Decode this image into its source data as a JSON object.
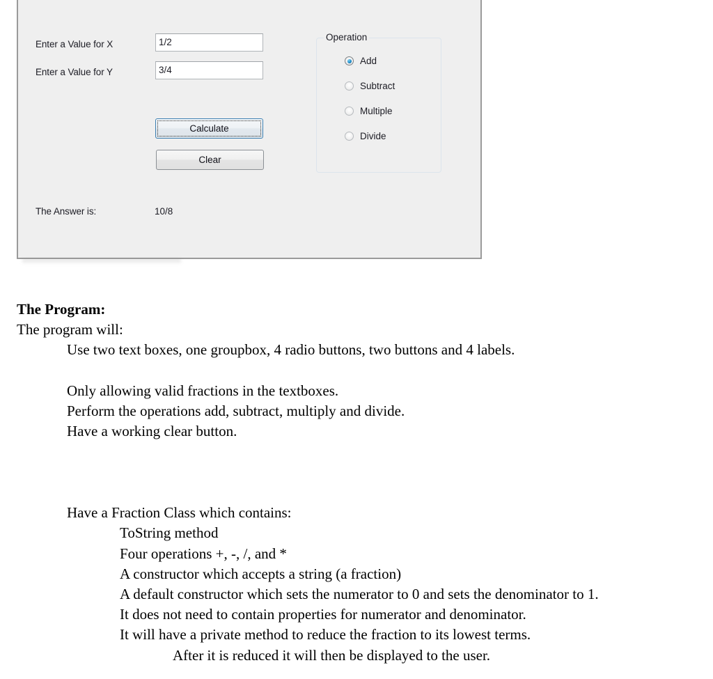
{
  "winform": {
    "labels": {
      "x": "Enter a Value for X",
      "y": "Enter a Value for Y",
      "answer": "The Answer is:"
    },
    "inputs": {
      "x_value": "1/2",
      "y_value": "3/4"
    },
    "answer_value": "10/8",
    "buttons": {
      "calculate": "Calculate",
      "clear": "Clear"
    },
    "groupbox": {
      "title": "Operation",
      "options": [
        {
          "label": "Add",
          "checked": true
        },
        {
          "label": "Subtract",
          "checked": false
        },
        {
          "label": "Multiple",
          "checked": false
        },
        {
          "label": "Divide",
          "checked": false
        }
      ]
    },
    "colors": {
      "form_background": "#efefef",
      "focus_border": "#3c7fb1",
      "radio_selected": "#1d8bc9"
    }
  },
  "document": {
    "heading": "The Program:",
    "intro": "The program will:",
    "requirements": [
      "Use two text boxes, one groupbox, 4 radio buttons, two buttons and 4 labels.",
      "Only allowing valid fractions in the textboxes.",
      "Perform the operations add, subtract, multiply and divide.",
      "Have a working clear button."
    ],
    "class_heading": "Have a Fraction Class which contains:",
    "class_items": [
      "ToString method",
      "Four operations +, -, /, and *",
      "A constructor which accepts a string (a fraction)",
      "A default constructor which sets the numerator to 0 and sets the denominator to 1.",
      "It does not need to contain properties for numerator and denominator.",
      "It will have a private method to reduce the fraction to its lowest terms."
    ],
    "class_subitem": "After it is reduced it will then be displayed to the user."
  }
}
